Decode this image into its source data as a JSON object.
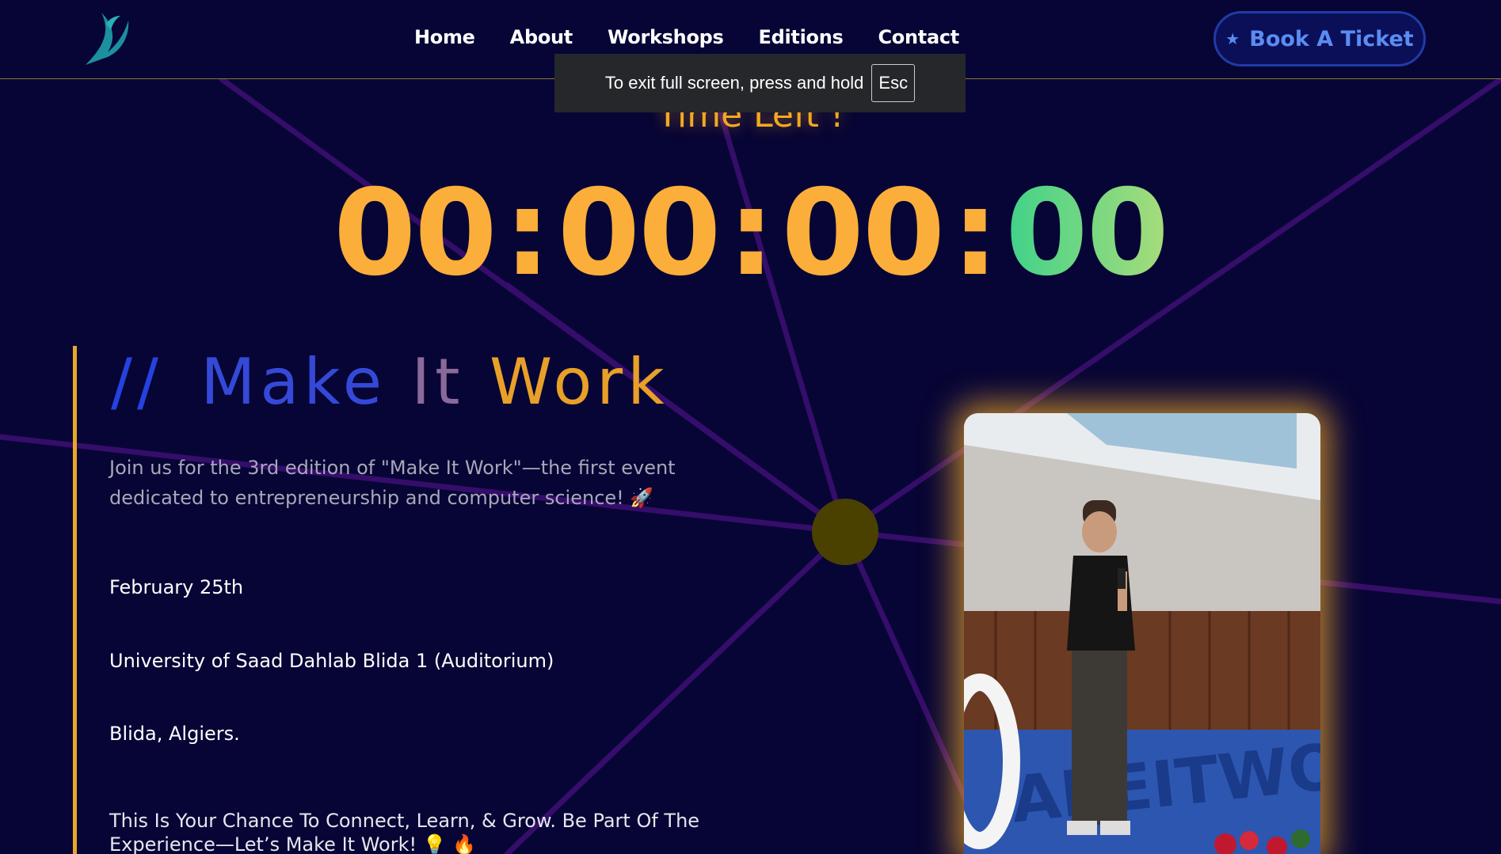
{
  "nav": {
    "logo_icon": "bird-logo-icon",
    "links": [
      "Home",
      "About",
      "Workshops",
      "Editions",
      "Contact"
    ],
    "book_button": "Book A Ticket",
    "book_icon": "star-icon"
  },
  "fullscreen_notice": {
    "text": "To exit full screen, press and hold",
    "key": "Esc"
  },
  "countdown": {
    "heading": "Time Left !",
    "segments": [
      "00",
      "00",
      "00",
      "00"
    ],
    "separator": ":"
  },
  "event": {
    "title_prefix": "//",
    "title_words": [
      "Make",
      "It",
      "Work"
    ],
    "intro": "Join us for the 3rd edition of \"Make It Work\"—the first event dedicated to entrepreneurship and computer science! 🚀",
    "date": "February 25th",
    "venue": "University of Saad Dahlab Blida 1 (Auditorium)",
    "city": "Blida, Algiers.",
    "cta": "This Is Your Chance To Connect, Learn, & Grow. Be Part Of The Experience—Let’s Make It Work! 💡 🔥"
  },
  "colors": {
    "background": "#070535",
    "accent_gold": "#f3a81f",
    "accent_blue": "#2542e0",
    "lines": "#3a0f6b"
  }
}
